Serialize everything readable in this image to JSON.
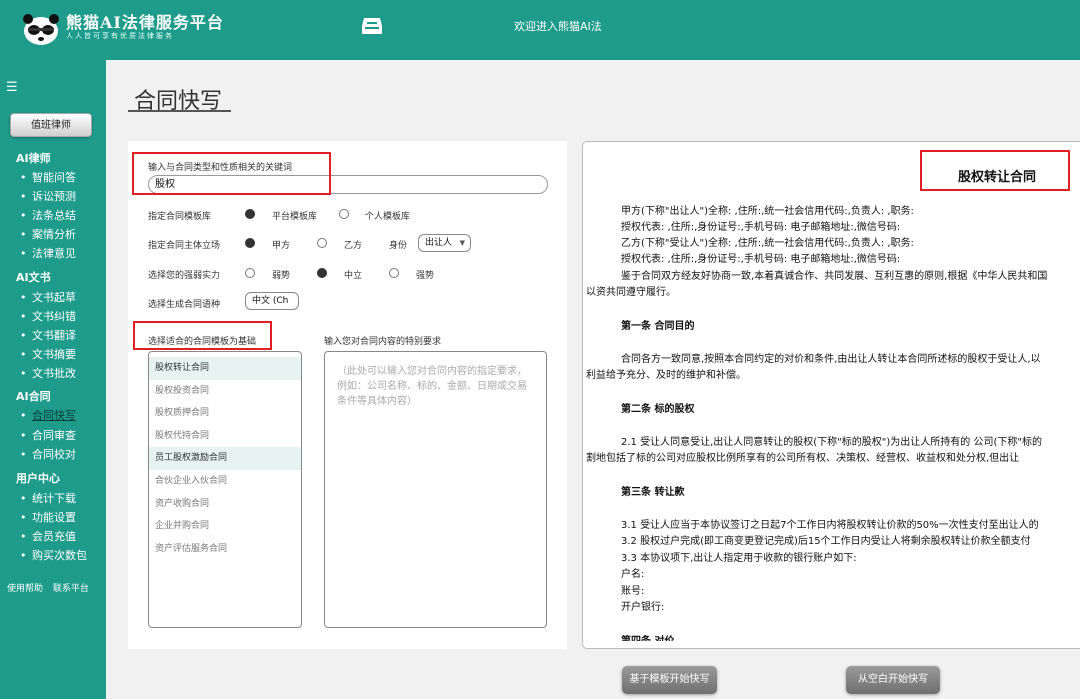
{
  "header": {
    "brand_title": "熊猫AI法律服务平台",
    "brand_subtitle": "人人皆可享有优质法律服务",
    "welcome": "欢迎进入熊猫AI法"
  },
  "sidebar": {
    "lawyer_button": "值班律师",
    "groups": [
      {
        "title": "AI律师",
        "items": [
          "智能问答",
          "诉讼预测",
          "法条总结",
          "案情分析",
          "法律意见"
        ]
      },
      {
        "title": "AI文书",
        "items": [
          "文书起草",
          "文书纠错",
          "文书翻译",
          "文书摘要",
          "文书批改"
        ]
      },
      {
        "title": "AI合同",
        "items": [
          "合同快写",
          "合同审查",
          "合同校对"
        ]
      },
      {
        "title": "用户中心",
        "items": [
          "统计下载",
          "功能设置",
          "会员充值",
          "购买次数包"
        ]
      }
    ],
    "active_item": "合同快写",
    "footer": [
      "使用帮助",
      "联系平台"
    ]
  },
  "page": {
    "title": "合同快写"
  },
  "form": {
    "keyword_label": "输入与合同类型和性质相关的关键词",
    "keyword_value": "股权",
    "library_label": "指定合同模板库",
    "library_options": [
      "平台模板库",
      "个人模板库"
    ],
    "library_selected": "平台模板库",
    "stance_label": "指定合同主体立场",
    "stance_options": [
      "甲方",
      "乙方"
    ],
    "stance_selected": "甲方",
    "identity_label": "身份",
    "identity_value": "出让人",
    "strength_label": "选择您的强弱实力",
    "strength_options": [
      "弱势",
      "中立",
      "强势"
    ],
    "strength_selected": "中立",
    "language_label": "选择生成合同语种",
    "language_value": "中文 (Ch",
    "template_label": "选择适合的合同模板为基础",
    "templates": [
      {
        "name": "股权转让合同",
        "highlight": true
      },
      {
        "name": "股权投资合同",
        "highlight": false
      },
      {
        "name": "股权质押合同",
        "highlight": false
      },
      {
        "name": "股权代持合同",
        "highlight": false
      },
      {
        "name": "员工股权激励合同",
        "highlight": true
      },
      {
        "name": "合伙企业入伙合同",
        "highlight": false
      },
      {
        "name": "资产收购合同",
        "highlight": false
      },
      {
        "name": "企业并购合同",
        "highlight": false
      },
      {
        "name": "资产评估服务合同",
        "highlight": false
      }
    ],
    "requirements_label": "输入您对合同内容的特别要求",
    "requirements_placeholder": "（此处可以输入您对合同内容的指定要求，例如：公司名称、标的、金额、日期或交易条件等具体内容）"
  },
  "document": {
    "title": "股权转让合同",
    "lines": [
      "甲方(下称\"出让人\")全称: ,住所:,统一社会信用代码:,负责人: ,职务:",
      "授权代表: ,住所:,身份证号:,手机号码: 电子邮箱地址:,微信号码:",
      "乙方(下称\"受让人\")全称: ,住所:,统一社会信用代码:,负责人: ,职务:",
      "授权代表: ,住所:,身份证号:,手机号码: 电子邮箱地址:,微信号码:",
      "鉴于合同双方经友好协商一致,本着真诚合作、共同发展、互利互惠的原则,根据《中华人民共和国",
      "以资共同遵守履行。"
    ],
    "section1_title": "第一条 合同目的",
    "section1_lines": [
      "合同各方一致同意,按照本合同约定的对价和条件,由出让人转让本合同所述标的股权于受让人,以",
      "利益给予充分、及时的维护和补偿。"
    ],
    "section2_title": "第二条 标的股权",
    "section2_lines": [
      "2.1 受让人同意受让,出让人同意转让的股权(下称\"标的股权\")为出让人所持有的 公司(下称\"标的",
      "割地包括了标的公司对应股权比例所享有的公司所有权、决策权、经营权、收益权和处分权,但出让"
    ],
    "section3_title": "第三条 转让款",
    "section3_lines": [
      "3.1 受让人应当于本协议签订之日起7个工作日内将股权转让价款的50%一次性支付至出让人的",
      "3.2 股权过户完成(即工商变更登记完成)后15个工作日内受让人将剩余股权转让价款全额支付",
      "3.3 本协议项下,出让人指定用于收款的银行账户如下:",
      "户名:",
      "账号:",
      "开户银行:"
    ],
    "section4_title": "第四条 对价"
  },
  "actions": {
    "template_button": "基于模板开始快写",
    "blank_button": "从空白开始快写"
  },
  "colors": {
    "brand": "#1e9b8a",
    "highlight": "#e02020"
  }
}
